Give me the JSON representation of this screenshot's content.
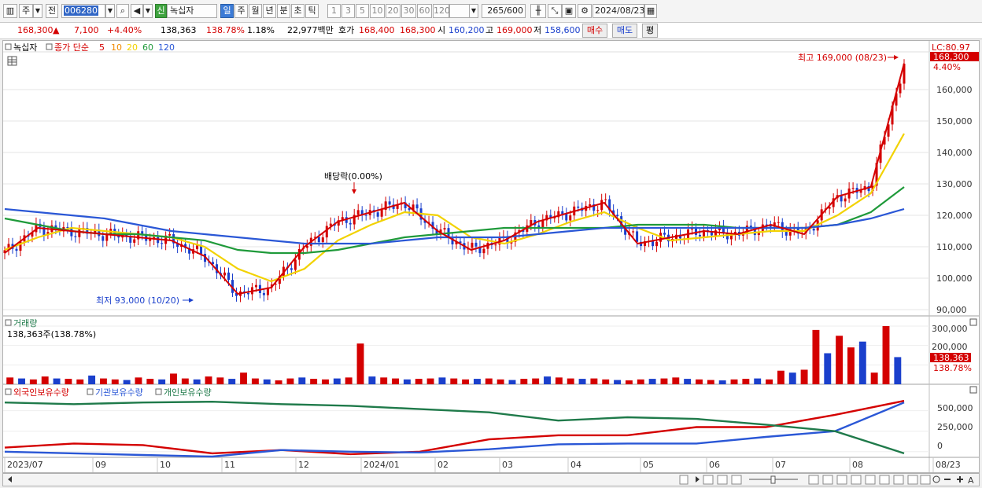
{
  "toolbar": {
    "type_label": "주",
    "prev_label": "전",
    "stock_code": "006280",
    "new_badge": "신",
    "stock_name": "녹십자",
    "periods": [
      "일",
      "주",
      "월",
      "년",
      "분",
      "초",
      "틱"
    ],
    "active_period": "일",
    "intervals": [
      "1",
      "3",
      "5",
      "10",
      "20",
      "30",
      "60",
      "120"
    ],
    "count_value": "265",
    "count_total": "/600",
    "date_value": "2024/08/23"
  },
  "quote": {
    "price": "168,300",
    "change_arrow": "▲",
    "change": "7,100",
    "change_pct": "+4.40%",
    "volume": "138,363",
    "volume_ratio": "138.78%",
    "turnover_pct": "1.18%",
    "trade_value": "22,977백만",
    "bid_label": "호가",
    "ask_price": "168,400",
    "bid_price": "168,300",
    "open_label": "시",
    "open": "160,200",
    "high_label": "고",
    "high": "169,000",
    "low_label": "저",
    "low": "158,600",
    "buy_label": "매수",
    "sell_label": "매도",
    "eval_label": "평"
  },
  "price_panel": {
    "name_label": "녹십자",
    "ma_prefix": "종가 단순",
    "ma_periods": [
      "5",
      "10",
      "20",
      "60",
      "120"
    ],
    "ma_colors": [
      "#d40000",
      "#f08a00",
      "#f2d200",
      "#1f9a3a",
      "#2a57d6"
    ],
    "lc_label": "LC:80.97",
    "current_price_tag": "168,300",
    "current_pct_tag": "4.40%",
    "high_annotation": "최고 169,000 (08/23)",
    "low_annotation": "최저 93,000 (10/20)",
    "dividend_annotation": "배당락(0.00%)"
  },
  "volume_panel": {
    "title": "거래량",
    "info": "138,363주(138.78%)",
    "tag_value": "138,363",
    "tag_pct": "138.78%",
    "y_ticks": [
      "300,000",
      "200,000",
      "100,000"
    ]
  },
  "holding_panel": {
    "series": [
      {
        "name": "외국인보유수량",
        "color": "#d40000"
      },
      {
        "name": "기관보유수량",
        "color": "#2a57d6"
      },
      {
        "name": "개인보유수량",
        "color": "#1f7a4a"
      }
    ],
    "y_ticks": [
      "500,000",
      "250,000",
      "0"
    ]
  },
  "x_axis": {
    "labels": [
      "2023/07",
      "09",
      "10",
      "11",
      "12",
      "2024/01",
      "02",
      "03",
      "04",
      "05",
      "06",
      "07",
      "08",
      "08/23"
    ]
  },
  "chart_data": [
    {
      "type": "line",
      "title": "",
      "y_ticks": [
        "160,000",
        "150,000",
        "140,000",
        "130,000",
        "120,000",
        "110,000",
        "100,000",
        "90,000"
      ],
      "ylim": [
        88000,
        172000
      ],
      "x": [
        "2023/07",
        "07",
        "08",
        "08",
        "09",
        "09",
        "10",
        "10",
        "11",
        "11",
        "12",
        "12",
        "2024/01",
        "01",
        "02",
        "02",
        "03",
        "03",
        "04",
        "04",
        "05",
        "05",
        "06",
        "06",
        "07",
        "07",
        "08",
        "08/23"
      ],
      "series": [
        {
          "name": "종가",
          "color": "#d40000",
          "values": [
            108000,
            116000,
            115000,
            114000,
            113000,
            112000,
            107000,
            95000,
            97000,
            110000,
            118000,
            121000,
            124000,
            115000,
            109000,
            112000,
            118000,
            121000,
            124000,
            111000,
            113000,
            115000,
            114000,
            117000,
            114000,
            126000,
            129000,
            168300
          ]
        },
        {
          "name": "20",
          "color": "#f2d200",
          "values": [
            109000,
            113000,
            116000,
            115000,
            114000,
            113000,
            110000,
            103000,
            99000,
            103000,
            112000,
            117000,
            121000,
            120000,
            113000,
            111000,
            114000,
            118000,
            121000,
            116000,
            112000,
            113000,
            114000,
            115000,
            115000,
            120000,
            127000,
            146000
          ]
        },
        {
          "name": "60",
          "color": "#1f9a3a",
          "values": [
            119000,
            117000,
            115000,
            114000,
            114000,
            113000,
            112000,
            109000,
            108000,
            108000,
            109000,
            111000,
            113000,
            114000,
            115000,
            116000,
            116000,
            116000,
            116000,
            117000,
            117000,
            117000,
            116000,
            116000,
            116000,
            117000,
            121000,
            129000
          ]
        },
        {
          "name": "120",
          "color": "#2a57d6",
          "values": [
            122000,
            121000,
            120000,
            119000,
            117000,
            115000,
            114000,
            113000,
            112000,
            111000,
            111000,
            111000,
            112000,
            113000,
            113000,
            113000,
            114000,
            115000,
            116000,
            116000,
            116000,
            116000,
            116000,
            116000,
            116000,
            117000,
            119000,
            122000
          ]
        }
      ]
    },
    {
      "type": "bar",
      "title": "거래량",
      "ylim": [
        0,
        320000
      ],
      "values": [
        35000,
        30000,
        25000,
        40000,
        30000,
        28000,
        25000,
        45000,
        30000,
        25000,
        22000,
        35000,
        28000,
        25000,
        55000,
        30000,
        25000,
        40000,
        35000,
        28000,
        60000,
        30000,
        25000,
        20000,
        30000,
        35000,
        28000,
        25000,
        30000,
        35000,
        210000,
        40000,
        35000,
        30000,
        25000,
        28000,
        30000,
        35000,
        30000,
        25000,
        28000,
        30000,
        25000,
        22000,
        28000,
        30000,
        40000,
        35000,
        30000,
        28000,
        30000,
        25000,
        22000,
        20000,
        25000,
        28000,
        30000,
        35000,
        28000,
        25000,
        22000,
        20000,
        25000,
        28000,
        30000,
        25000,
        70000,
        60000,
        75000,
        280000,
        160000,
        250000,
        190000,
        220000,
        60000,
        300000,
        140000
      ]
    },
    {
      "type": "line",
      "title": "",
      "ylim": [
        -50000,
        650000
      ],
      "x": [
        "2023/07",
        "09",
        "10",
        "11",
        "12",
        "2024/01",
        "02",
        "03",
        "04",
        "05",
        "06",
        "07",
        "08",
        "08/23"
      ],
      "series": [
        {
          "name": "외국인보유수량",
          "values": [
            50000,
            100000,
            80000,
            -20000,
            20000,
            -30000,
            0,
            150000,
            200000,
            200000,
            300000,
            300000,
            450000,
            620000
          ]
        },
        {
          "name": "기관보유수량",
          "values": [
            0,
            -20000,
            -40000,
            -60000,
            20000,
            0,
            -10000,
            30000,
            90000,
            100000,
            100000,
            180000,
            250000,
            600000
          ]
        },
        {
          "name": "개인보유수량",
          "values": [
            600000,
            580000,
            600000,
            610000,
            580000,
            560000,
            520000,
            480000,
            380000,
            420000,
            400000,
            330000,
            250000,
            -20000
          ]
        }
      ]
    }
  ]
}
